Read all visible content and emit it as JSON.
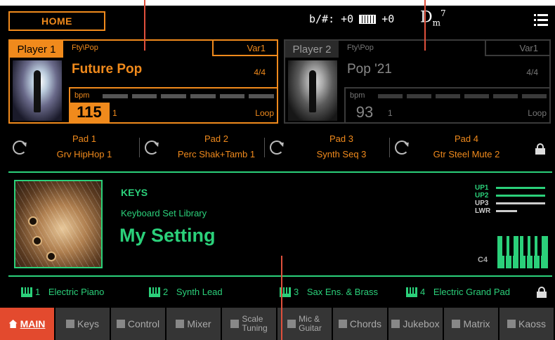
{
  "topbar": {
    "home_label": "HOME",
    "transpose_text": "b/#: +0",
    "octave_text": "+0",
    "chord_root": "D",
    "chord_quality": "m",
    "chord_ext": "7"
  },
  "player1": {
    "label": "Player 1",
    "category": "Fty\\Pop",
    "variation": "Var1",
    "song": "Future Pop",
    "meter": "4/4",
    "bpm_label": "bpm",
    "bpm": "115",
    "beat": "1",
    "mode": "Loop"
  },
  "player2": {
    "label": "Player 2",
    "category": "Fty\\Pop",
    "variation": "Var1",
    "song": "Pop '21",
    "meter": "4/4",
    "bpm_label": "bpm",
    "bpm": "93",
    "beat": "1",
    "mode": "Loop"
  },
  "pads": [
    {
      "num": "Pad 1",
      "name": "Grv HipHop 1"
    },
    {
      "num": "Pad 2",
      "name": "Perc Shak+Tamb 1"
    },
    {
      "num": "Pad 3",
      "name": "Synth Seq 3"
    },
    {
      "num": "Pad 4",
      "name": "Gtr Steel Mute 2"
    }
  ],
  "keyboard_set": {
    "category": "KEYS",
    "library": "Keyboard Set Library",
    "name": "My Setting",
    "note": "C4",
    "layers": [
      {
        "name": "UP1",
        "color": "#2bd07a"
      },
      {
        "name": "UP2",
        "color": "#2bd07a"
      },
      {
        "name": "UP3",
        "color": "#cccccc"
      },
      {
        "name": "LWR",
        "color": "#cccccc"
      }
    ]
  },
  "sounds": [
    {
      "num": "1",
      "name": "Electric Piano"
    },
    {
      "num": "2",
      "name": "Synth Lead"
    },
    {
      "num": "3",
      "name": "Sax Ens. & Brass"
    },
    {
      "num": "4",
      "name": "Electric Grand Pad"
    }
  ],
  "tabs": [
    {
      "label": "MAIN",
      "active": true
    },
    {
      "label": "Keys"
    },
    {
      "label": "Control"
    },
    {
      "label": "Mixer"
    },
    {
      "label": "Scale",
      "label2": "Tuning"
    },
    {
      "label": "Mic &",
      "label2": "Guitar"
    },
    {
      "label": "Chords"
    },
    {
      "label": "Jukebox"
    },
    {
      "label": "Matrix"
    },
    {
      "label": "Kaoss"
    }
  ],
  "colors": {
    "accent_orange": "#f08a1c",
    "accent_green": "#2bd07a",
    "active_tab": "#e34a2e"
  }
}
